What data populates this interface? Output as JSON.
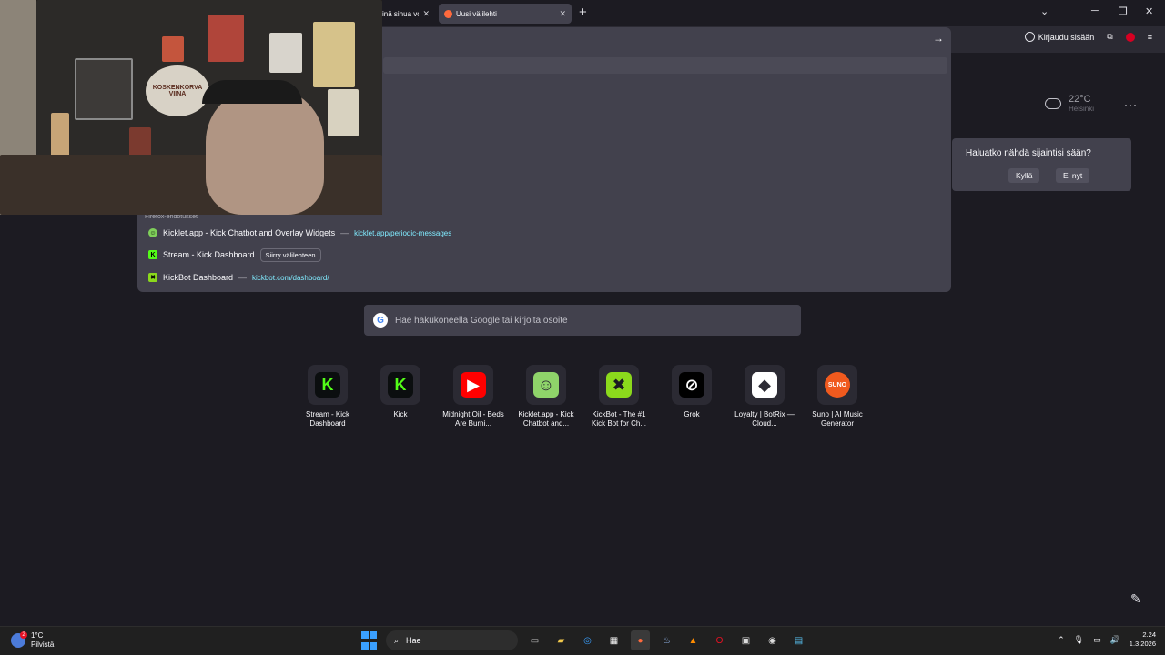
{
  "tabs": {
    "previous_title": "inä sinua vo",
    "active_title": "Uusi välilehti",
    "new_tab_icon": "plus-icon"
  },
  "toolbar": {
    "signin_label": "Kirjaudu sisään"
  },
  "url_dropdown": {
    "header": "Firefox-ehdotukset",
    "suggestions": [
      {
        "title": "Kicklet.app - Kick Chatbot and Overlay Widgets",
        "separator": "—",
        "url": "kicklet.app/periodic-messages"
      },
      {
        "title": "Stream - Kick Dashboard",
        "switch_label": "Siirry välilehteen"
      },
      {
        "title": "KickBot Dashboard",
        "separator": "—",
        "url": "kickbot.com/dashboard/"
      }
    ]
  },
  "weather": {
    "temperature": "22°C",
    "city": "Helsinki",
    "popup_question": "Haluatko nähdä sijaintisi sään?",
    "yes_label": "Kyllä",
    "no_label": "Ei nyt"
  },
  "webcam": {
    "sign_text_1": "KOSKENKORVA",
    "sign_text_2": "VIINA"
  },
  "search": {
    "placeholder": "Hae hakukoneella Google tai kirjoita osoite"
  },
  "shortcuts": [
    {
      "label": "Stream - Kick Dashboard",
      "glyph": "K",
      "color": "#53fc18",
      "bg": "#0b0e0f"
    },
    {
      "label": "Kick",
      "glyph": "K",
      "color": "#53fc18",
      "bg": "#0b0e0f"
    },
    {
      "label": "Midnight Oil - Beds Are Burni...",
      "glyph": "▶",
      "color": "#ffffff",
      "bg": "#ff0000"
    },
    {
      "label": "Kicklet.app - Kick Chatbot and...",
      "glyph": "☺",
      "color": "#2b2a33",
      "bg": "#8fd46a"
    },
    {
      "label": "KickBot - The #1 Kick Bot for Ch...",
      "glyph": "✖",
      "color": "#1c1b22",
      "bg": "#8bd91c"
    },
    {
      "label": "Grok",
      "glyph": "⊘",
      "color": "#ffffff",
      "bg": "#000000"
    },
    {
      "label": "Loyalty | BotRix — Cloud...",
      "glyph": "◆",
      "color": "#2b2a33",
      "bg": "#ffffff"
    },
    {
      "label": "Suno | AI Music Generator",
      "glyph": "SUNO",
      "color": "#ffffff",
      "bg": "#f05a1e"
    }
  ],
  "taskbar": {
    "weather_temp": "1°C",
    "weather_desc": "Pilvistä",
    "weather_badge": "2",
    "search_label": "Hae",
    "time": "2.24",
    "date": "1.3.2026"
  }
}
